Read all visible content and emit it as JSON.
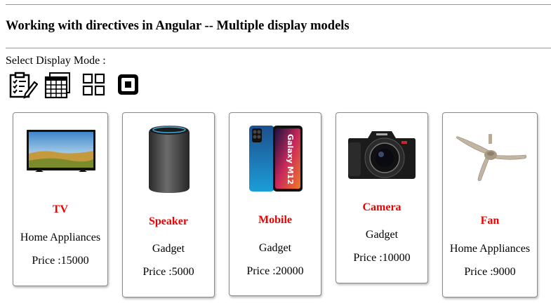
{
  "page": {
    "heading": "Working with directives in Angular -- Multiple display models",
    "mode_label": "Select Display Mode :"
  },
  "display_modes": [
    {
      "icon": "form-list-icon",
      "label": "form"
    },
    {
      "icon": "table-grid-icon",
      "label": "table"
    },
    {
      "icon": "tile-grid-icon",
      "label": "tiles"
    },
    {
      "icon": "single-card-icon",
      "label": "card"
    }
  ],
  "products": [
    {
      "name": "TV",
      "category": "Home Appliances",
      "price": "Price :15000"
    },
    {
      "name": "Speaker",
      "category": "Gadget",
      "price": "Price :5000"
    },
    {
      "name": "Mobile",
      "category": "Gadget",
      "price": "Price :20000"
    },
    {
      "name": "Camera",
      "category": "Gadget",
      "price": "Price :10000"
    },
    {
      "name": "Fan",
      "category": "Home Appliances",
      "price": "Price :9000"
    }
  ],
  "colors": {
    "product_name": "#ee0000",
    "rule": "#9a9a9a",
    "card_border": "#8a8a8a"
  }
}
